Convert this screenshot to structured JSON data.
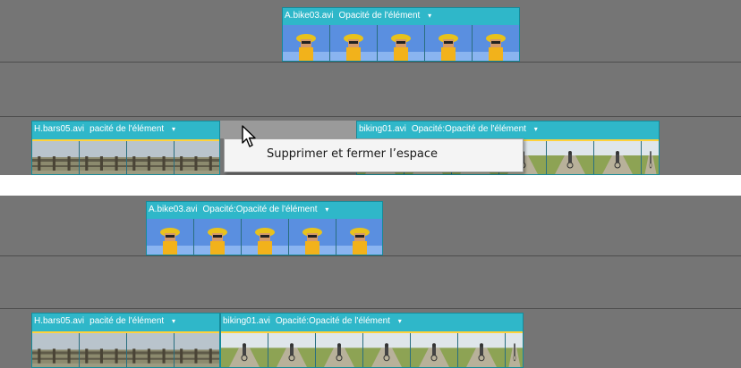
{
  "before": {
    "top_clip": {
      "name": "A.bike03.avi",
      "effect": "Opacité de l'élément",
      "caret": "▾"
    },
    "bottom_left_clip": {
      "name": "H.bars05.avi",
      "effect": "pacité de l'élément",
      "caret": "▾"
    },
    "bottom_right_clip": {
      "name": "biking01.avi",
      "effect": "Opacité:Opacité de l'élément",
      "caret": "▾"
    },
    "context_menu": {
      "item": "Supprimer et fermer l’espace"
    }
  },
  "after": {
    "top_clip": {
      "name": "A.bike03.avi",
      "effect": "Opacité:Opacité de l'élément",
      "caret": "▾"
    },
    "bottom_left_clip": {
      "name": "H.bars05.avi",
      "effect": "pacité de l'élément",
      "caret": "▾"
    },
    "bottom_right_clip": {
      "name": "biking01.avi",
      "effect": "Opacité:Opacité de l'élément",
      "caret": "▾"
    }
  },
  "colors": {
    "track_bg": "#757575",
    "clip_header": "#2fb7c9",
    "opacity_line": "#ffd23a",
    "gap_selection": "#9a9a9a",
    "menu_bg": "#f4f4f4"
  },
  "icons": [
    "mouse-pointer-icon"
  ]
}
